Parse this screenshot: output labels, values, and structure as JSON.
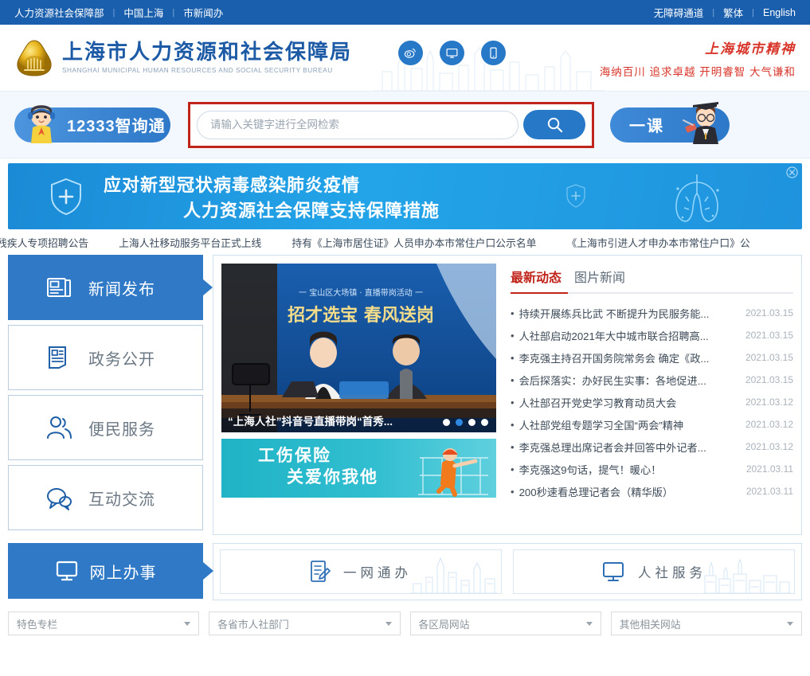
{
  "topbar": {
    "left_links": [
      "人力资源社会保障部",
      "中国上海",
      "市新闻办"
    ],
    "right_links": [
      "无障碍通道",
      "繁体",
      "English"
    ],
    "separator": "|",
    "bg_color": "#1a5fad"
  },
  "header": {
    "title_cn": "上海市人力资源和社会保障局",
    "title_en": "SHANGHAI MUNICIPAL HUMAN RESOURCES AND SOCIAL SECURITY BUREAU",
    "icons": [
      "weibo-icon",
      "desktop-icon",
      "mobile-icon"
    ],
    "spirit_title": "上海城市精神",
    "spirit_sub": "海纳百川 追求卓越 开明睿智 大气谦和",
    "spirit_color": "#d8352a",
    "brand_color": "#1c5aa6"
  },
  "search": {
    "zxt_label": "12333智询通",
    "placeholder": "请输入关键字进行全网检索",
    "value": "",
    "search_icon": "search-icon",
    "yike_label": "一课",
    "highlight_color": "#c0241b"
  },
  "banner": {
    "line1": "应对新型冠状病毒感染肺炎疫情",
    "line2": "人力资源社会保障支持保障措施",
    "close_icon": "close-icon",
    "bg_color": "#23a4e8"
  },
  "marquee": {
    "links": [
      "残疾人专项招聘公告",
      "上海人社移动服务平台正式上线",
      "持有《上海市居住证》人员申办本市常住户口公示名单",
      "《上海市引进人才申办本市常住户口》公"
    ]
  },
  "sidebar": {
    "items": [
      {
        "label": "新闻发布",
        "icon": "newspaper-icon",
        "active": true
      },
      {
        "label": "政务公开",
        "icon": "document-icon",
        "active": false
      },
      {
        "label": "便民服务",
        "icon": "people-icon",
        "active": false
      },
      {
        "label": "互动交流",
        "icon": "chat-bubble-icon",
        "active": false
      }
    ],
    "active_color": "#2f79c6"
  },
  "video": {
    "headline_top": "一 宝山区大场镇 · 直播带岗活动 一",
    "headline_main": "招才选宝  春风送岗",
    "caption": "“上海人社”抖音号直播带岗“首秀...",
    "dots": 4,
    "active_dot": 2
  },
  "promo": {
    "line1": "工伤保险",
    "line2": "关爱你我他",
    "bg_color": "#31bed0"
  },
  "news": {
    "tabs": [
      {
        "label": "最新动态",
        "active": true
      },
      {
        "label": "图片新闻",
        "active": false
      }
    ],
    "active_color": "#c0241b",
    "items": [
      {
        "title": "持续开展练兵比武 不断提升为民服务能...",
        "date": "2021.03.15"
      },
      {
        "title": "人社部启动2021年大中城市联合招聘高...",
        "date": "2021.03.15"
      },
      {
        "title": "李克强主持召开国务院常务会 确定《政...",
        "date": "2021.03.15"
      },
      {
        "title": "会后探落实：办好民生实事：各地促进...",
        "date": "2021.03.15"
      },
      {
        "title": "人社部召开党史学习教育动员大会",
        "date": "2021.03.12"
      },
      {
        "title": "人社部党组专题学习全国“两会”精神",
        "date": "2021.03.12"
      },
      {
        "title": "李克强总理出席记者会并回答中外记者...",
        "date": "2021.03.12"
      },
      {
        "title": "李克强这9句话，提气！暖心！",
        "date": "2021.03.11"
      },
      {
        "title": "200秒速看总理记者会（精华版）",
        "date": "2021.03.11"
      }
    ]
  },
  "service": {
    "left_label": "网上办事",
    "left_icon": "monitor-icon",
    "cards": [
      {
        "label": "一网通办",
        "icon": "form-pen-icon"
      },
      {
        "label": "人社服务",
        "icon": "monitor-icon"
      }
    ]
  },
  "footer": {
    "selects": [
      {
        "label": "特色专栏"
      },
      {
        "label": "各省市人社部门"
      },
      {
        "label": "各区局网站"
      },
      {
        "label": "其他相关网站"
      }
    ],
    "caret_icon": "chevron-down-icon"
  }
}
